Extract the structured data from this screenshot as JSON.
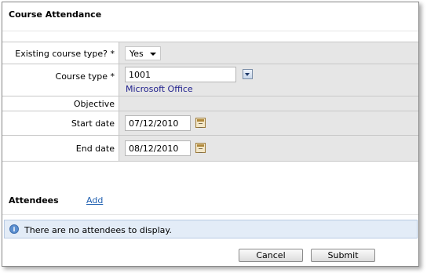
{
  "panel": {
    "title": "Course Attendance"
  },
  "form": {
    "existing_course_type": {
      "label": "Existing course type? *",
      "value": "Yes"
    },
    "course_type": {
      "label": "Course type *",
      "value": "1001",
      "description": "Microsoft Office"
    },
    "objective": {
      "label": "Objective"
    },
    "start_date": {
      "label": "Start date",
      "value": "07/12/2010"
    },
    "end_date": {
      "label": "End date",
      "value": "08/12/2010"
    }
  },
  "attendees": {
    "label": "Attendees",
    "add_label": "Add",
    "empty_message": "There are no attendees to display."
  },
  "actions": {
    "cancel_label": "Cancel",
    "submit_label": "Submit"
  }
}
